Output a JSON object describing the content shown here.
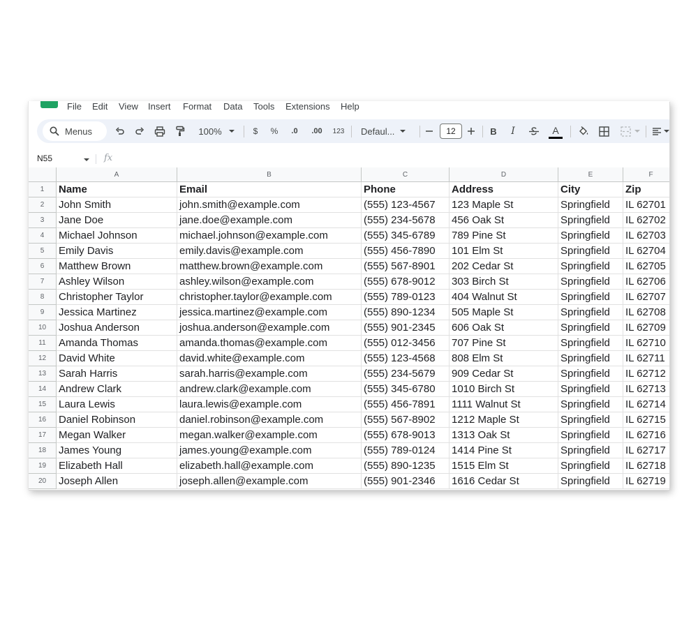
{
  "menu": [
    "File",
    "Edit",
    "View",
    "Insert",
    "Format",
    "Data",
    "Tools",
    "Extensions",
    "Help"
  ],
  "toolbar": {
    "search_label": "Menus",
    "zoom": "100%",
    "currency": "$",
    "percent": "%",
    "decrease_decimals": ".0",
    "increase_decimals": ".00",
    "number_format": "123",
    "font": "Defaul...",
    "font_size": "12",
    "bold": "B",
    "italic": "I",
    "text_color": "A"
  },
  "formula_bar": {
    "cell_ref": "N55",
    "fx": "fx",
    "formula": ""
  },
  "columns": [
    "A",
    "B",
    "C",
    "D",
    "E",
    "F"
  ],
  "rows": [
    {
      "num": "1",
      "cells": [
        "Name",
        "Email",
        "Phone",
        "Address",
        "City",
        "Zip"
      ]
    },
    {
      "num": "2",
      "cells": [
        "John Smith",
        "john.smith@example.com",
        "(555) 123-4567",
        "123 Maple St",
        "Springfield",
        "IL 62701"
      ]
    },
    {
      "num": "3",
      "cells": [
        "Jane Doe",
        "jane.doe@example.com",
        "(555) 234-5678",
        "456 Oak St",
        "Springfield",
        "IL 62702"
      ]
    },
    {
      "num": "4",
      "cells": [
        "Michael Johnson",
        "michael.johnson@example.com",
        "(555) 345-6789",
        "789 Pine St",
        "Springfield",
        "IL 62703"
      ]
    },
    {
      "num": "5",
      "cells": [
        "Emily Davis",
        "emily.davis@example.com",
        "(555) 456-7890",
        "101 Elm St",
        "Springfield",
        "IL 62704"
      ]
    },
    {
      "num": "6",
      "cells": [
        "Matthew Brown",
        "matthew.brown@example.com",
        "(555) 567-8901",
        "202 Cedar St",
        "Springfield",
        "IL 62705"
      ]
    },
    {
      "num": "7",
      "cells": [
        "Ashley Wilson",
        "ashley.wilson@example.com",
        "(555) 678-9012",
        "303 Birch St",
        "Springfield",
        "IL 62706"
      ]
    },
    {
      "num": "8",
      "cells": [
        "Christopher Taylor",
        "christopher.taylor@example.com",
        "(555) 789-0123",
        "404 Walnut St",
        "Springfield",
        "IL 62707"
      ]
    },
    {
      "num": "9",
      "cells": [
        "Jessica Martinez",
        "jessica.martinez@example.com",
        "(555) 890-1234",
        "505 Maple St",
        "Springfield",
        "IL 62708"
      ]
    },
    {
      "num": "10",
      "cells": [
        "Joshua Anderson",
        "joshua.anderson@example.com",
        "(555) 901-2345",
        "606 Oak St",
        "Springfield",
        "IL 62709"
      ]
    },
    {
      "num": "11",
      "cells": [
        "Amanda Thomas",
        "amanda.thomas@example.com",
        "(555) 012-3456",
        "707 Pine St",
        "Springfield",
        "IL 62710"
      ]
    },
    {
      "num": "12",
      "cells": [
        "David White",
        "david.white@example.com",
        "(555) 123-4568",
        "808 Elm St",
        "Springfield",
        "IL 62711"
      ]
    },
    {
      "num": "13",
      "cells": [
        "Sarah Harris",
        "sarah.harris@example.com",
        "(555) 234-5679",
        "909 Cedar St",
        "Springfield",
        "IL 62712"
      ]
    },
    {
      "num": "14",
      "cells": [
        "Andrew Clark",
        "andrew.clark@example.com",
        "(555) 345-6780",
        "1010 Birch St",
        "Springfield",
        "IL 62713"
      ]
    },
    {
      "num": "15",
      "cells": [
        "Laura Lewis",
        "laura.lewis@example.com",
        "(555) 456-7891",
        "1111 Walnut St",
        "Springfield",
        "IL 62714"
      ]
    },
    {
      "num": "16",
      "cells": [
        "Daniel Robinson",
        "daniel.robinson@example.com",
        "(555) 567-8902",
        "1212 Maple St",
        "Springfield",
        "IL 62715"
      ]
    },
    {
      "num": "17",
      "cells": [
        "Megan Walker",
        "megan.walker@example.com",
        "(555) 678-9013",
        "1313 Oak St",
        "Springfield",
        "IL 62716"
      ]
    },
    {
      "num": "18",
      "cells": [
        "James Young",
        "james.young@example.com",
        "(555) 789-0124",
        "1414 Pine St",
        "Springfield",
        "IL 62717"
      ]
    },
    {
      "num": "19",
      "cells": [
        "Elizabeth Hall",
        "elizabeth.hall@example.com",
        "(555) 890-1235",
        "1515 Elm St",
        "Springfield",
        "IL 62718"
      ]
    },
    {
      "num": "20",
      "cells": [
        "Joseph Allen",
        "joseph.allen@example.com",
        "(555) 901-2346",
        "1616 Cedar St",
        "Springfield",
        "IL 62719"
      ]
    }
  ],
  "colors": {
    "brand_green": "#1ea362",
    "toolbar_bg": "#eef2f9",
    "header_bg": "#f8f9fa"
  }
}
